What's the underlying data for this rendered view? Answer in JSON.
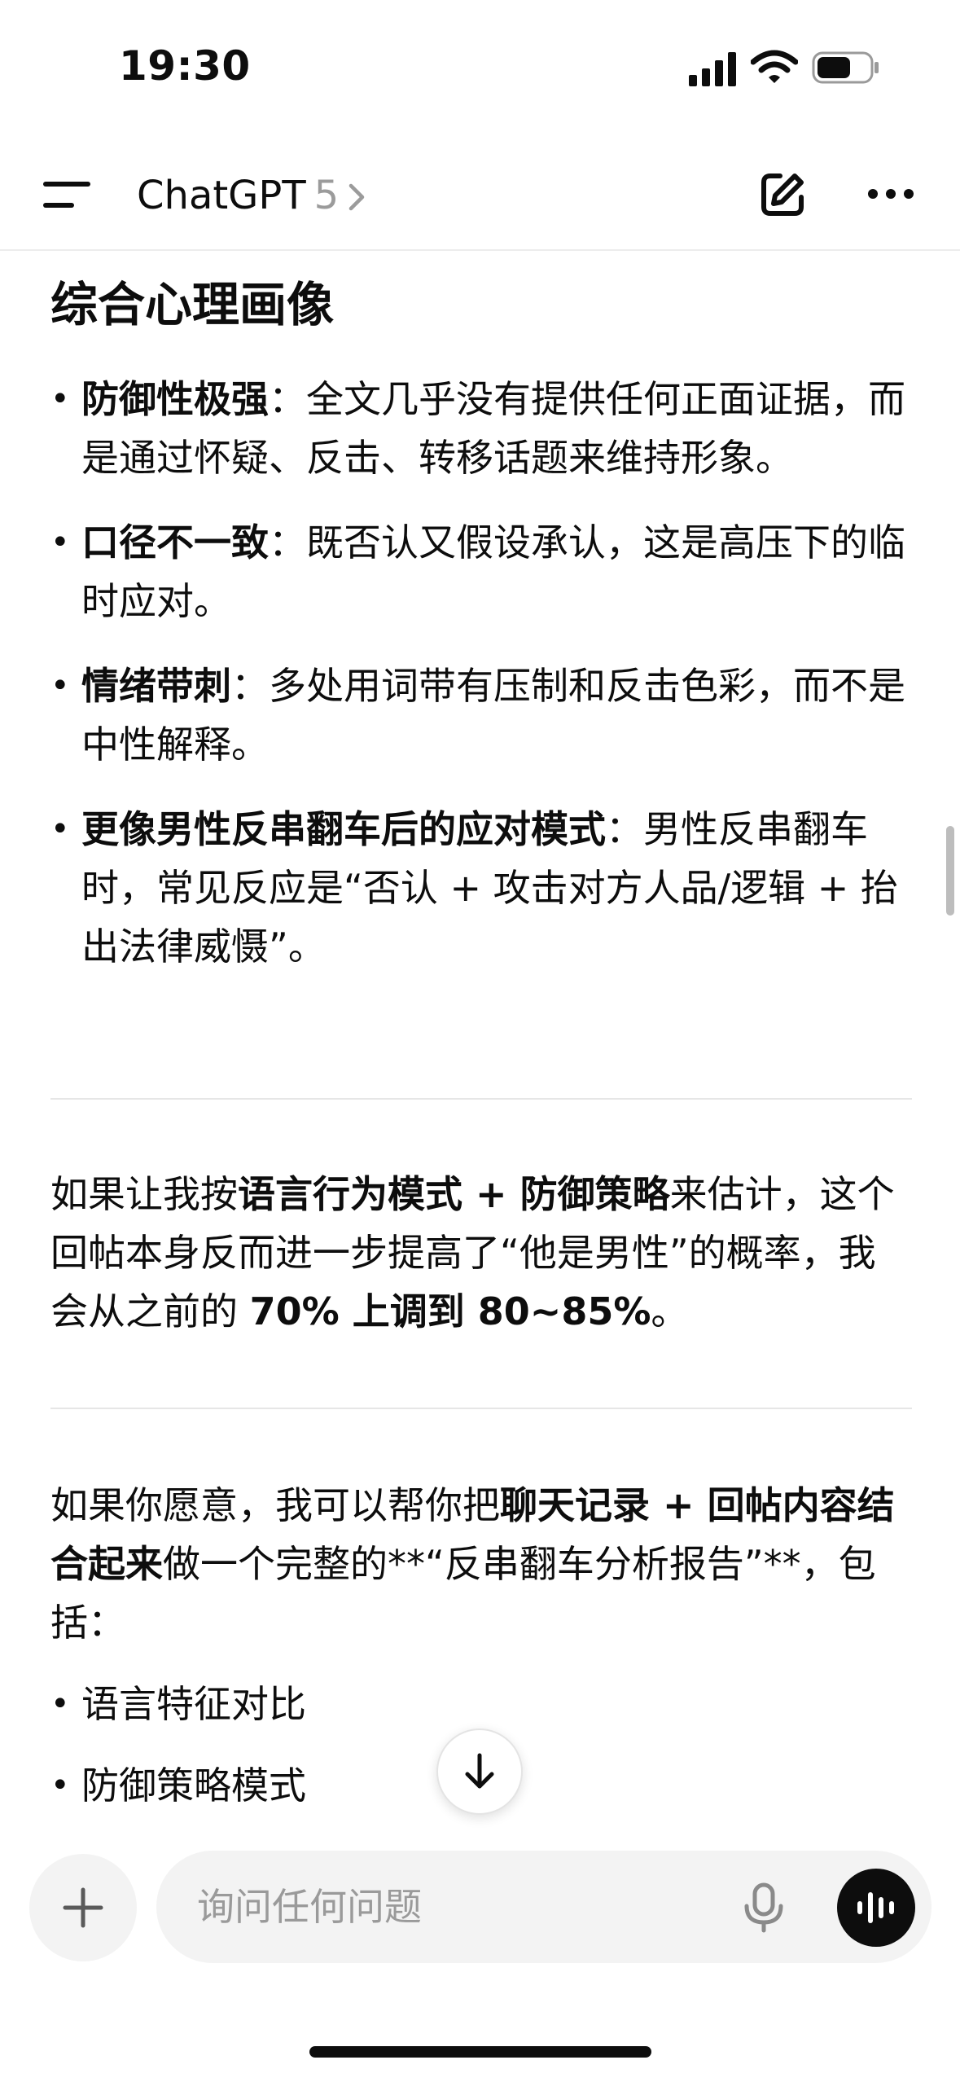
{
  "status_bar": {
    "time": "19:30"
  },
  "header": {
    "title": "ChatGPT",
    "version": "5"
  },
  "content": {
    "heading": "综合心理画像",
    "bullets": [
      {
        "bold": "防御性极强",
        "text": "：全文几乎没有提供任何正面证据，而是通过怀疑、反击、转移话题来维持形象。"
      },
      {
        "bold": "口径不一致",
        "text": "：既否认又假设承认，这是高压下的临时应对。"
      },
      {
        "bold": "情绪带刺",
        "text": "：多处用词带有压制和反击色彩，而不是中性解释。"
      },
      {
        "bold": "更像男性反串翻车后的应对模式",
        "text": "：男性反串翻车时，常见反应是“否认 + 攻击对方人品/逻辑 + 抬出法律威慑”。"
      }
    ],
    "estimate_para": {
      "t1": "如果让我按",
      "b1": "语言行为模式 + 防御策略",
      "t2": "来估计，这个回帖本身反而进一步提高了“他是男性”的概率，我会从之前的 ",
      "b2": "70% 上调到 80~85%",
      "t3": "。"
    },
    "offer_para": {
      "t1": "如果你愿意，我可以帮你把",
      "b1": "聊天记录 + 回帖内容结合起来",
      "t2": "做一个完整的**“反串翻车分析报告”**，包括："
    },
    "offer_bullets": [
      "语言特征对比",
      "防御策略模式"
    ]
  },
  "input": {
    "placeholder": "询问任何问题",
    "value": ""
  }
}
